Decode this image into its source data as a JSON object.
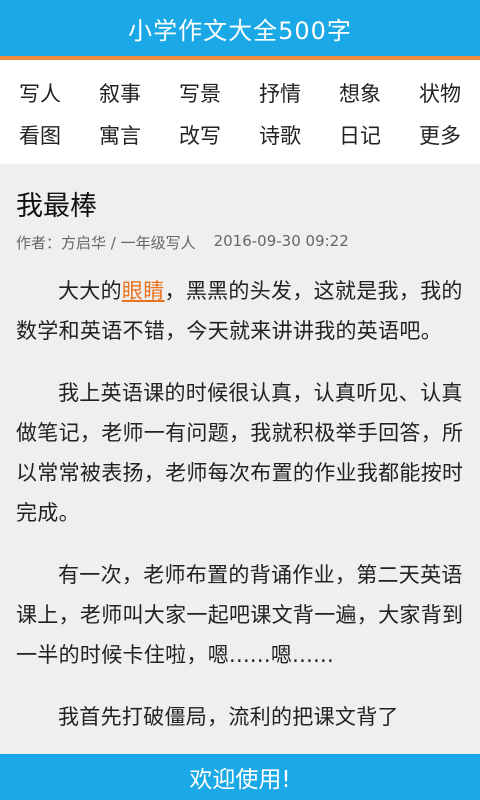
{
  "header": {
    "title": "小学作文大全500字"
  },
  "categories": {
    "row1": [
      "写人",
      "叙事",
      "写景",
      "抒情",
      "想象",
      "状物"
    ],
    "row2": [
      "看图",
      "寓言",
      "改写",
      "诗歌",
      "日记",
      "更多"
    ]
  },
  "article": {
    "title": "我最棒",
    "author_line": "作者：方启华 / 一年级写人",
    "date": "2016-09-30 09:22",
    "p1_before": "大大的",
    "p1_link": "眼睛",
    "p1_after": "，黑黑的头发，这就是我，我的数学和英语不错，今天就来讲讲我的英语吧。",
    "p2": "我上英语课的时候很认真，认真听见、认真做笔记，老师一有问题，我就积极举手回答，所以常常被表扬，老师每次布置的作业我都能按时完成。",
    "p3": "有一次，老师布置的背诵作业，第二天英语课上，老师叫大家一起吧课文背一遍，大家背到一半的时候卡住啦，嗯......嗯......",
    "p4": "我首先打破僵局，流利的把课文背了"
  },
  "footer": {
    "welcome": "欢迎使用!"
  },
  "colors": {
    "primary": "#1ba8e6",
    "accent": "#f08a3c",
    "link": "#e8731e"
  }
}
